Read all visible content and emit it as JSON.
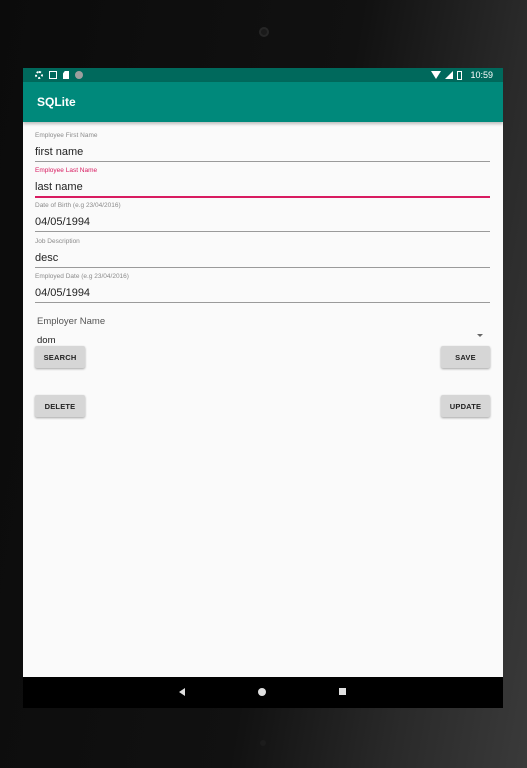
{
  "status_bar": {
    "time": "10:59",
    "icons": [
      "settings-icon",
      "image-icon",
      "sd-card-icon",
      "circle-status-icon",
      "wifi-icon",
      "signal-icon",
      "battery-icon"
    ]
  },
  "app_bar": {
    "title": "SQLite",
    "color": "#00897b",
    "status_color": "#00695c"
  },
  "form": {
    "first_name": {
      "label": "Employee First Name",
      "value": "first name"
    },
    "last_name": {
      "label": "Employee Last Name",
      "value": "last name",
      "focused": true,
      "accent": "#d81b60"
    },
    "dob": {
      "label": "Date of Birth (e.g 23/04/2016)",
      "value": "04/05/1994"
    },
    "job": {
      "label": "Job Description",
      "value": "desc"
    },
    "employed_date": {
      "label": "Employed Date (e.g 23/04/2016)",
      "value": "04/05/1994"
    },
    "employer": {
      "label": "Employer Name",
      "selected": "dom"
    }
  },
  "buttons": {
    "search": "SEARCH",
    "save": "SAVE",
    "delete": "DELETE",
    "update": "UPDATE"
  },
  "nav_bar": {
    "icons": [
      "back-icon",
      "home-icon",
      "recents-icon"
    ]
  }
}
